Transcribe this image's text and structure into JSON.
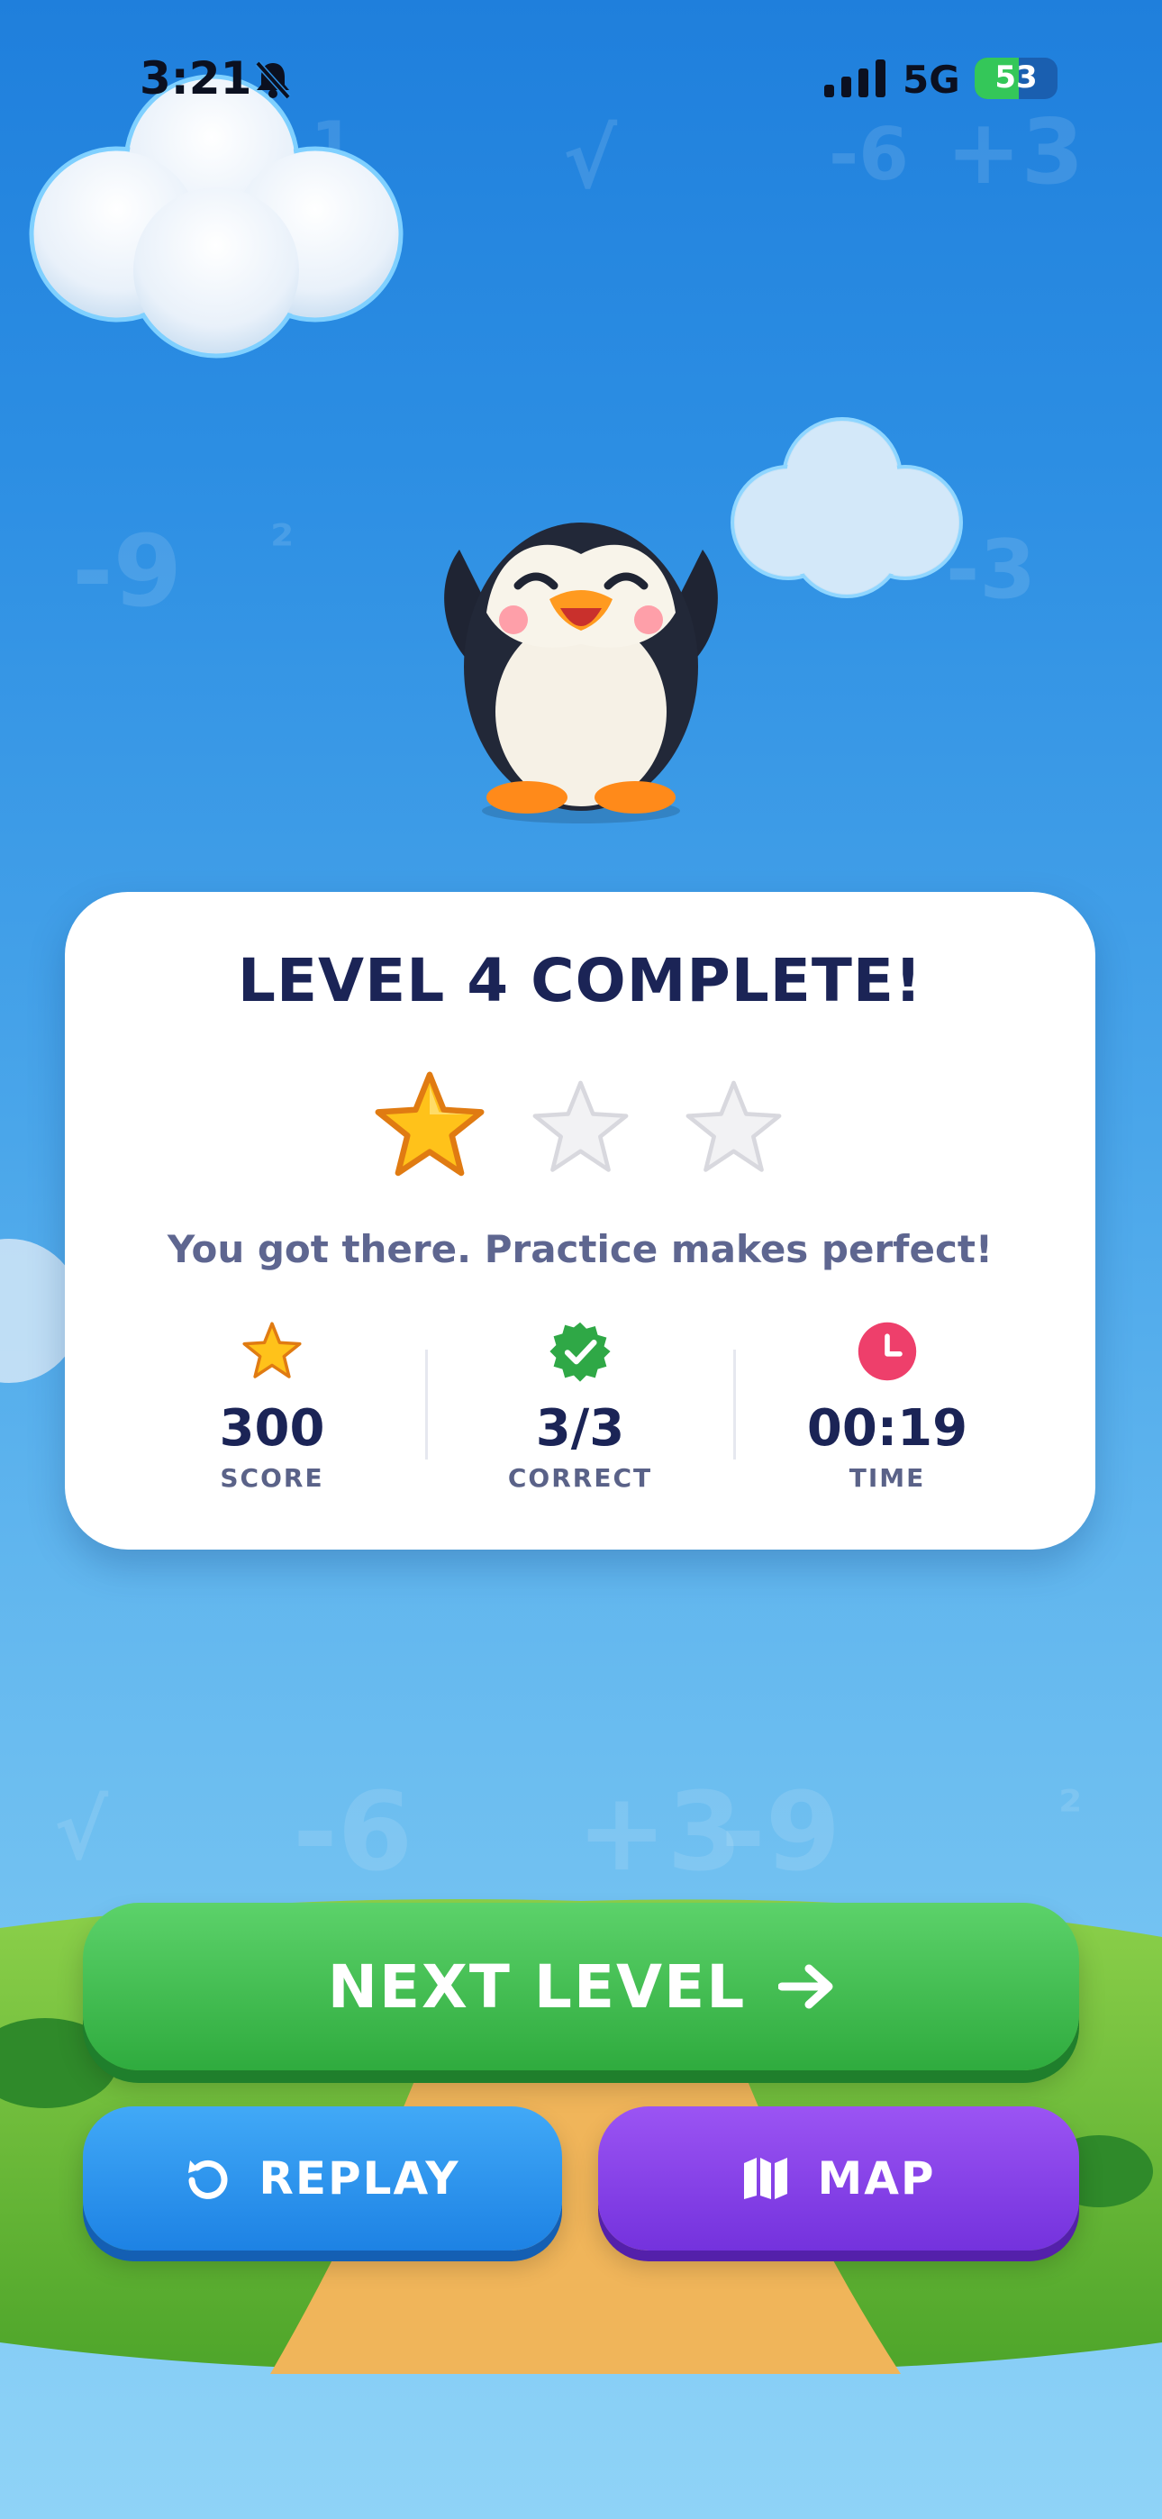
{
  "status_bar": {
    "time": "3:21",
    "network": "5G",
    "battery": "53",
    "battery_level": 0.53
  },
  "background_math": [
    "1",
    "√",
    "-6",
    "+3",
    "-9",
    "²",
    "-3",
    "√",
    "-6",
    "+3",
    "-9",
    "²"
  ],
  "result_card": {
    "title": "LEVEL 4 COMPLETE!",
    "stars_earned": 1,
    "stars_total": 3,
    "message": "You got there. Practice makes perfect!",
    "stats": [
      {
        "icon": "star-icon",
        "value": "300",
        "label": "SCORE"
      },
      {
        "icon": "check-badge-icon",
        "value": "3/3",
        "label": "CORRECT"
      },
      {
        "icon": "clock-icon",
        "value": "00:19",
        "label": "TIME"
      }
    ]
  },
  "buttons": {
    "next_level": "NEXT LEVEL",
    "replay": "REPLAY",
    "map": "MAP"
  },
  "colors": {
    "title": "#1b2456",
    "next_button": "#34b544",
    "replay_button": "#2a90ea",
    "map_button": "#8440e8",
    "star_gold": "#ffc21a",
    "check_green": "#2fa846",
    "clock_pink": "#ee3f6b"
  }
}
